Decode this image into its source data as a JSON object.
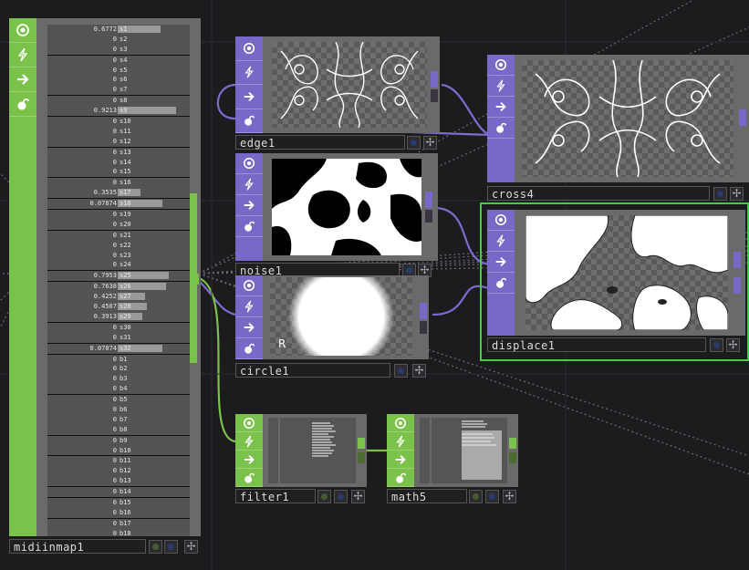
{
  "nodes": {
    "midiinmap": {
      "name": "midiinmap1"
    },
    "edge": {
      "name": "edge1"
    },
    "noise": {
      "name": "noise1"
    },
    "circle": {
      "name": "circle1",
      "overlay_label": "R"
    },
    "cross": {
      "name": "cross4"
    },
    "displace": {
      "name": "displace1"
    },
    "filter": {
      "name": "filter1"
    },
    "math": {
      "name": "math5"
    }
  },
  "midi_channels": [
    {
      "name": "s1",
      "value": "0.6772",
      "level": 0.6772
    },
    {
      "name": "s2",
      "value": "0",
      "level": 0
    },
    {
      "name": "s3",
      "value": "0",
      "level": 0
    },
    {
      "name": "s4",
      "value": "0",
      "level": 0
    },
    {
      "name": "s5",
      "value": "0",
      "level": 0
    },
    {
      "name": "s6",
      "value": "0",
      "level": 0
    },
    {
      "name": "s7",
      "value": "0",
      "level": 0
    },
    {
      "name": "s8",
      "value": "0",
      "level": 0
    },
    {
      "name": "s9",
      "value": "0.9213",
      "level": 0.9213
    },
    {
      "name": "s10",
      "value": "0",
      "level": 0
    },
    {
      "name": "s11",
      "value": "0",
      "level": 0
    },
    {
      "name": "s12",
      "value": "0",
      "level": 0
    },
    {
      "name": "s13",
      "value": "0",
      "level": 0
    },
    {
      "name": "s14",
      "value": "0",
      "level": 0
    },
    {
      "name": "s15",
      "value": "0",
      "level": 0
    },
    {
      "name": "s16",
      "value": "0",
      "level": 0
    },
    {
      "name": "s17",
      "value": "0.3535",
      "level": 0.3535
    },
    {
      "name": "s18",
      "value": "0.07874",
      "level": 0.7
    },
    {
      "name": "s19",
      "value": "0",
      "level": 0
    },
    {
      "name": "s20",
      "value": "0",
      "level": 0
    },
    {
      "name": "s21",
      "value": "0",
      "level": 0
    },
    {
      "name": "s22",
      "value": "0",
      "level": 0
    },
    {
      "name": "s23",
      "value": "0",
      "level": 0
    },
    {
      "name": "s24",
      "value": "0",
      "level": 0
    },
    {
      "name": "s25",
      "value": "0.7953",
      "level": 0.7953
    },
    {
      "name": "s26",
      "value": "0.7638",
      "level": 0.7638
    },
    {
      "name": "s27",
      "value": "0.4252",
      "level": 0.4252
    },
    {
      "name": "s28",
      "value": "0.4567",
      "level": 0.4567
    },
    {
      "name": "s29",
      "value": "0.3913",
      "level": 0.3913
    },
    {
      "name": "s30",
      "value": "0",
      "level": 0
    },
    {
      "name": "s31",
      "value": "0",
      "level": 0
    },
    {
      "name": "s32",
      "value": "0.07874",
      "level": 0.7
    },
    {
      "name": "b1",
      "value": "0",
      "level": 0
    },
    {
      "name": "b2",
      "value": "0",
      "level": 0
    },
    {
      "name": "b3",
      "value": "0",
      "level": 0
    },
    {
      "name": "b4",
      "value": "0",
      "level": 0
    },
    {
      "name": "b5",
      "value": "0",
      "level": 0
    },
    {
      "name": "b6",
      "value": "0",
      "level": 0
    },
    {
      "name": "b7",
      "value": "0",
      "level": 0
    },
    {
      "name": "b8",
      "value": "0",
      "level": 0
    },
    {
      "name": "b9",
      "value": "0",
      "level": 0
    },
    {
      "name": "b10",
      "value": "0",
      "level": 0
    },
    {
      "name": "b11",
      "value": "0",
      "level": 0
    },
    {
      "name": "b12",
      "value": "0",
      "level": 0
    },
    {
      "name": "b13",
      "value": "0",
      "level": 0
    },
    {
      "name": "b14",
      "value": "0",
      "level": 0
    },
    {
      "name": "b15",
      "value": "0",
      "level": 0
    },
    {
      "name": "b16",
      "value": "0",
      "level": 0
    },
    {
      "name": "b17",
      "value": "0",
      "level": 0
    },
    {
      "name": "b18",
      "value": "0",
      "level": 0
    },
    {
      "name": "b19",
      "value": "0",
      "level": 0
    },
    {
      "name": "b20",
      "value": "0",
      "level": 0
    }
  ],
  "underlined_rows": [
    "s3",
    "s7",
    "s9",
    "s12",
    "s15",
    "s17",
    "s18",
    "s20",
    "s24",
    "s25",
    "s29",
    "s31",
    "s32",
    "b4",
    "b8",
    "b10",
    "b13",
    "b14",
    "b16",
    "b19"
  ],
  "colors": {
    "top_family": "#7a68c8",
    "chop_family": "#7bc24a",
    "background": "#1c1c1f",
    "selected_outline": "#3fcf3f"
  },
  "icons": {
    "viewer": "target-icon",
    "bypass": "bolt-icon",
    "display": "arrow-right-icon",
    "lock": "lock-icon"
  }
}
